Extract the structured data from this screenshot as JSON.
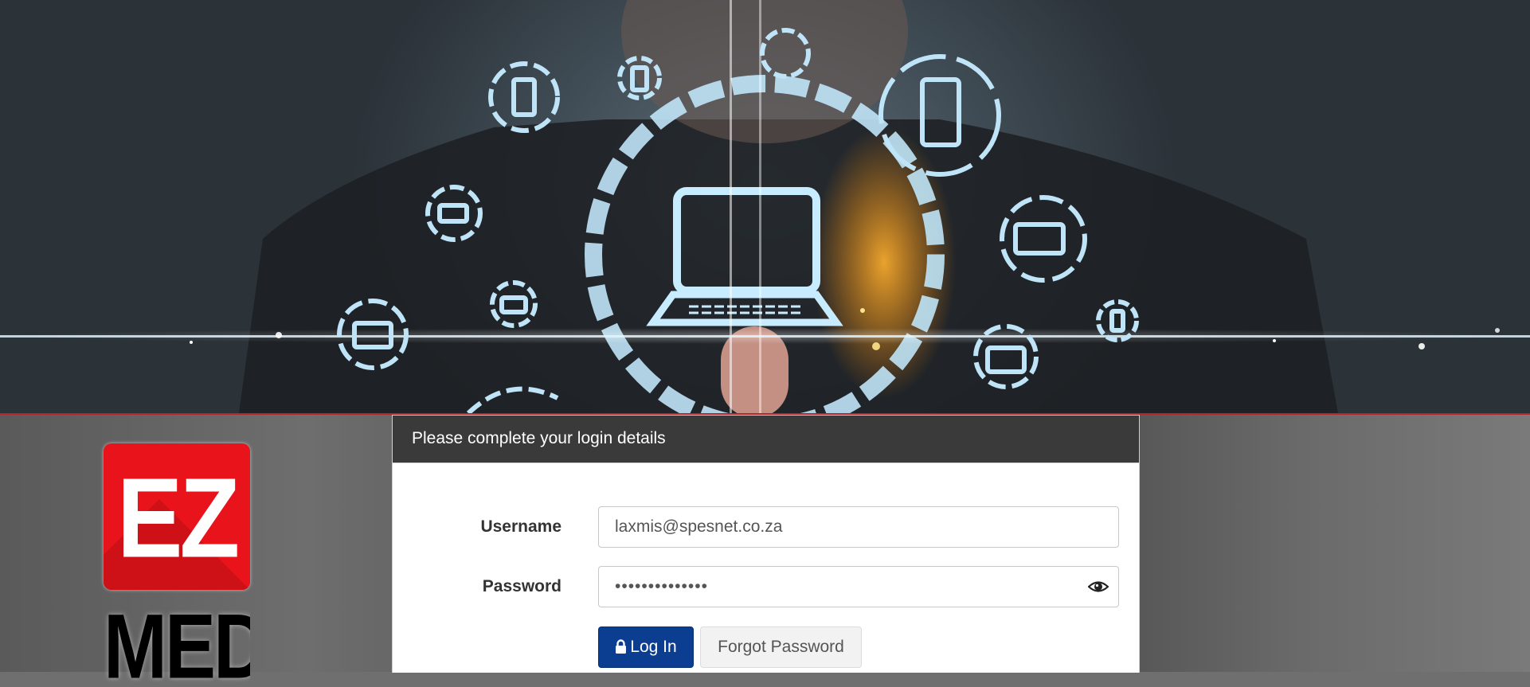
{
  "logo": {
    "line1": "EZ",
    "line2": "MED",
    "brand_color": "#e8131b"
  },
  "panel": {
    "title": "Please complete your login details"
  },
  "form": {
    "username_label": "Username",
    "username_value": "laxmis@spesnet.co.za",
    "password_label": "Password",
    "password_value": "••••••••••••••",
    "show_password_icon": "eye-icon"
  },
  "buttons": {
    "login_icon": "lock-icon",
    "login_label": "Log In",
    "forgot_label": "Forgot Password",
    "login_color": "#0b3d91"
  },
  "banner": {
    "accent_line_color": "#b3262c"
  }
}
